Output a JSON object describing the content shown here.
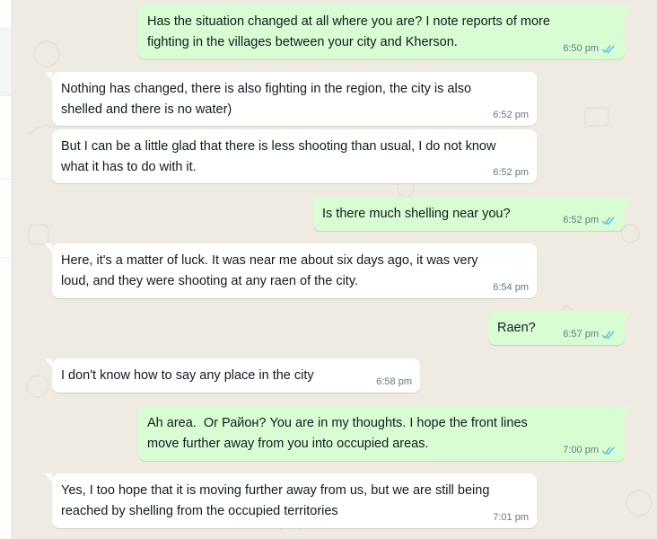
{
  "colors": {
    "chat_background": "#efeae2",
    "incoming_bubble": "#ffffff",
    "outgoing_bubble": "#d9fdd3",
    "timestamp": "#667781",
    "read_ticks": "#53bdeb"
  },
  "messages": [
    {
      "direction": "outgoing",
      "text": "Has the situation changed at all where you are? I note reports of more fighting in the villages between your city and Kherson.",
      "time": "6:50 pm",
      "status_icon": "double-check-read-icon"
    },
    {
      "direction": "incoming",
      "text": "Nothing has changed, there is also fighting in the region, the city is also shelled and there is no water)",
      "time": "6:52 pm"
    },
    {
      "direction": "incoming",
      "text": "But I can be a little glad that there is less shooting than usual, I do not know what it has to do with it.",
      "time": "6:52 pm"
    },
    {
      "direction": "outgoing",
      "text": "Is there much shelling near you?",
      "time": "6:52 pm",
      "status_icon": "double-check-read-icon"
    },
    {
      "direction": "incoming",
      "text": "Here, it's a matter of luck. It was near me about six days ago, it was very loud, and they were shooting at any raen of the city.",
      "time": "6:54 pm"
    },
    {
      "direction": "outgoing",
      "text": "Raen?",
      "time": "6:57 pm",
      "status_icon": "double-check-read-icon"
    },
    {
      "direction": "incoming",
      "text": "I don't know how to say any place in the city",
      "time": "6:58 pm"
    },
    {
      "direction": "outgoing",
      "text": "Ah area.  Or Район? You are in my thoughts. I hope the front lines move further away from you into occupied areas.",
      "time": "7:00 pm",
      "status_icon": "double-check-read-icon"
    },
    {
      "direction": "incoming",
      "text": "Yes, I too hope that it is moving further away from us, but we are still being reached by shelling from the occupied territories",
      "time": "7:01 pm"
    }
  ]
}
